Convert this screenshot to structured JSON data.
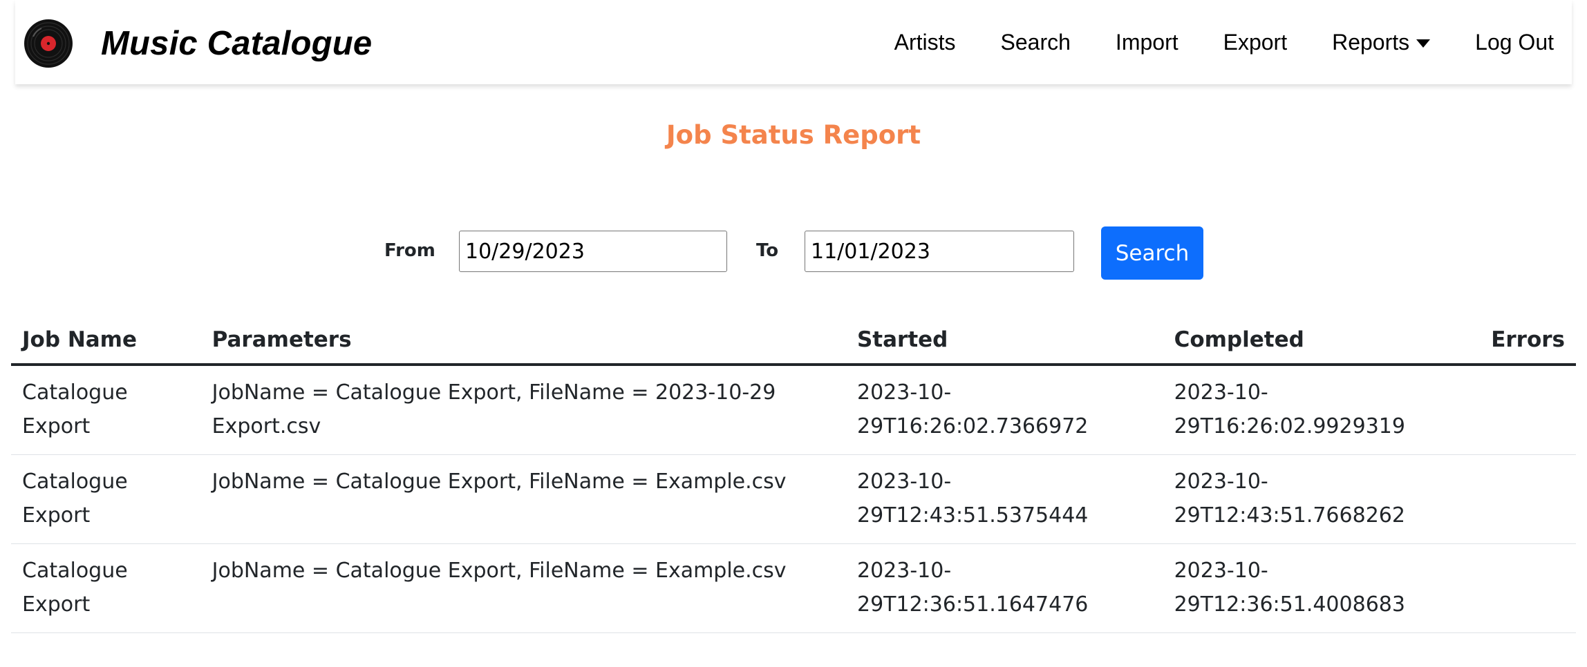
{
  "app": {
    "title": "Music Catalogue",
    "logo_icon": "vinyl-record-icon",
    "accent_color": "#f4844c",
    "primary_color": "#0d6efd"
  },
  "nav": {
    "artists": "Artists",
    "search": "Search",
    "import": "Import",
    "export": "Export",
    "reports": "Reports",
    "logout": "Log Out"
  },
  "page": {
    "title": "Job Status Report"
  },
  "form": {
    "from_label": "From",
    "from_value": "10/29/2023",
    "to_label": "To",
    "to_value": "11/01/2023",
    "search_label": "Search"
  },
  "table": {
    "headers": {
      "job_name": "Job Name",
      "parameters": "Parameters",
      "started": "Started",
      "completed": "Completed",
      "errors": "Errors"
    },
    "rows": [
      {
        "job_name": "Catalogue Export",
        "parameters": "JobName = Catalogue Export, FileName = 2023-10-29 Export.csv",
        "started": "2023-10-29T16:26:02.7366972",
        "completed": "2023-10-29T16:26:02.9929319",
        "errors": ""
      },
      {
        "job_name": "Catalogue Export",
        "parameters": "JobName = Catalogue Export, FileName = Example.csv",
        "started": "2023-10-29T12:43:51.5375444",
        "completed": "2023-10-29T12:43:51.7668262",
        "errors": ""
      },
      {
        "job_name": "Catalogue Export",
        "parameters": "JobName = Catalogue Export, FileName = Example.csv",
        "started": "2023-10-29T12:36:51.1647476",
        "completed": "2023-10-29T12:36:51.4008683",
        "errors": ""
      }
    ]
  }
}
